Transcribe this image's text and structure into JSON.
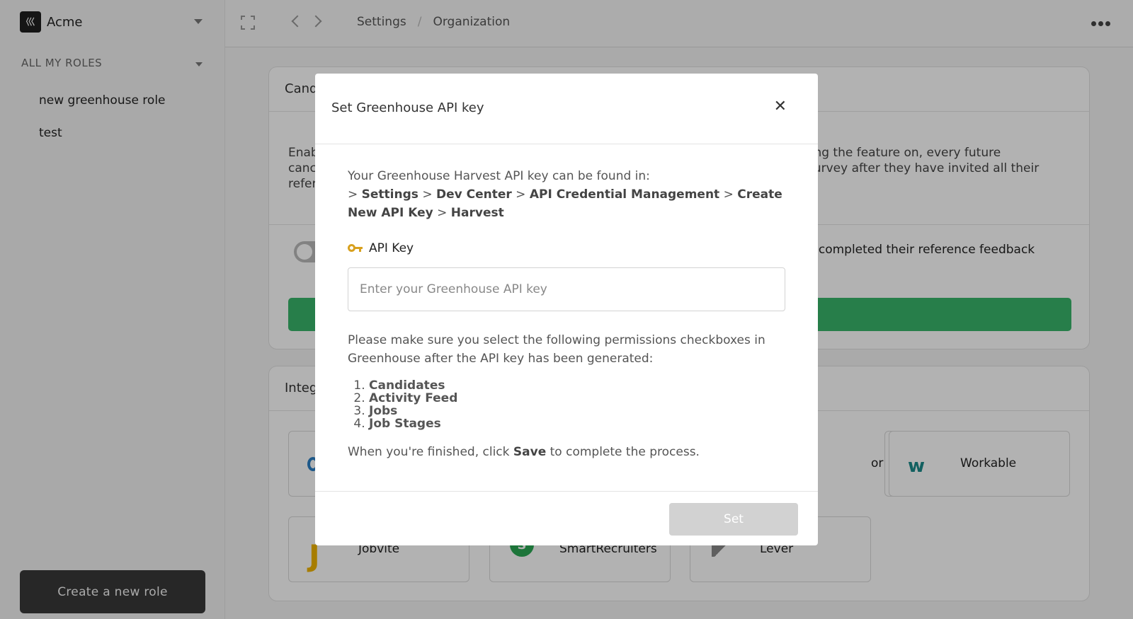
{
  "sidebar": {
    "workspace": "Acme",
    "roles_header": "ALL MY ROLES",
    "roles": [
      "new greenhouse role",
      "test"
    ],
    "create_button": "Create a new role"
  },
  "topbar": {
    "breadcrumb": [
      "Settings",
      "Organization"
    ]
  },
  "main": {
    "card1": {
      "title": "Cand",
      "desc_left": "Enab\ncanc\nrefer",
      "desc_right": "ling the feature on, every future\nsurvey after they have invited all their",
      "toggle_label": "e completed their reference feedback"
    },
    "card2": {
      "title": "Integ",
      "tiles": [
        "Jobvite",
        "SmartRecruiters",
        "Lever",
        "Workable",
        "or"
      ]
    }
  },
  "modal": {
    "title": "Set Greenhouse API key",
    "intro": "Your Greenhouse Harvest API key can be found in:",
    "path": [
      "Settings",
      "Dev Center",
      "API Credential Management",
      "Create New API Key",
      "Harvest"
    ],
    "path_sep": ">",
    "key_label": "API Key",
    "input_placeholder": "Enter your Greenhouse API key",
    "input_value": "",
    "permissions_text": "Please make sure you select the following permissions checkboxes in Greenhouse after the API key has been generated:",
    "permissions": [
      "Candidates",
      "Activity Feed",
      "Jobs",
      "Job Stages"
    ],
    "finish_pre": "When you're finished, click",
    "finish_bold": "Save",
    "finish_post": "to complete the process.",
    "set_button": "Set"
  },
  "colors": {
    "accent_green": "#39b56a",
    "overlay": "rgba(0,0,0,0.30)",
    "disabled_button": "#d2d2d2",
    "sidebar_button": "#383838"
  }
}
